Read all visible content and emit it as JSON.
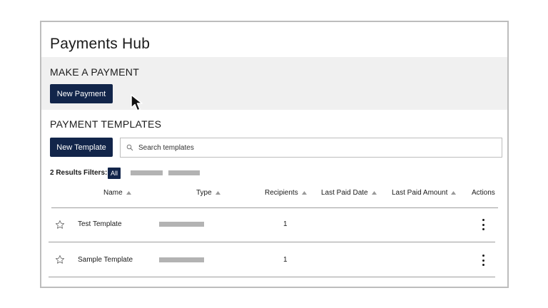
{
  "page": {
    "title": "Payments Hub"
  },
  "make_payment": {
    "heading": "MAKE A PAYMENT",
    "button_label": "New Payment"
  },
  "templates": {
    "heading": "PAYMENT TEMPLATES",
    "new_button_label": "New Template",
    "search_placeholder": "Search templates",
    "results_text": "2 Results",
    "filters_label": "Filters:",
    "filter_all": "All",
    "columns": {
      "name": "Name",
      "type": "Type",
      "recipients": "Recipients",
      "last_paid_date": "Last Paid Date",
      "last_paid_amount": "Last Paid Amount",
      "actions": "Actions"
    },
    "rows": [
      {
        "name": "Test Template",
        "recipients": "1"
      },
      {
        "name": "Sample Template",
        "recipients": "1"
      }
    ]
  },
  "icons": {
    "cursor": "arrow-pointer-icon",
    "search": "search-icon",
    "star": "star-outline-icon",
    "sort": "sort-up-icon",
    "kebab": "more-vertical-icon"
  },
  "colors": {
    "primary": "#12254a",
    "band": "#f0f0f0",
    "placeholder_bar": "#b3b3b3"
  }
}
